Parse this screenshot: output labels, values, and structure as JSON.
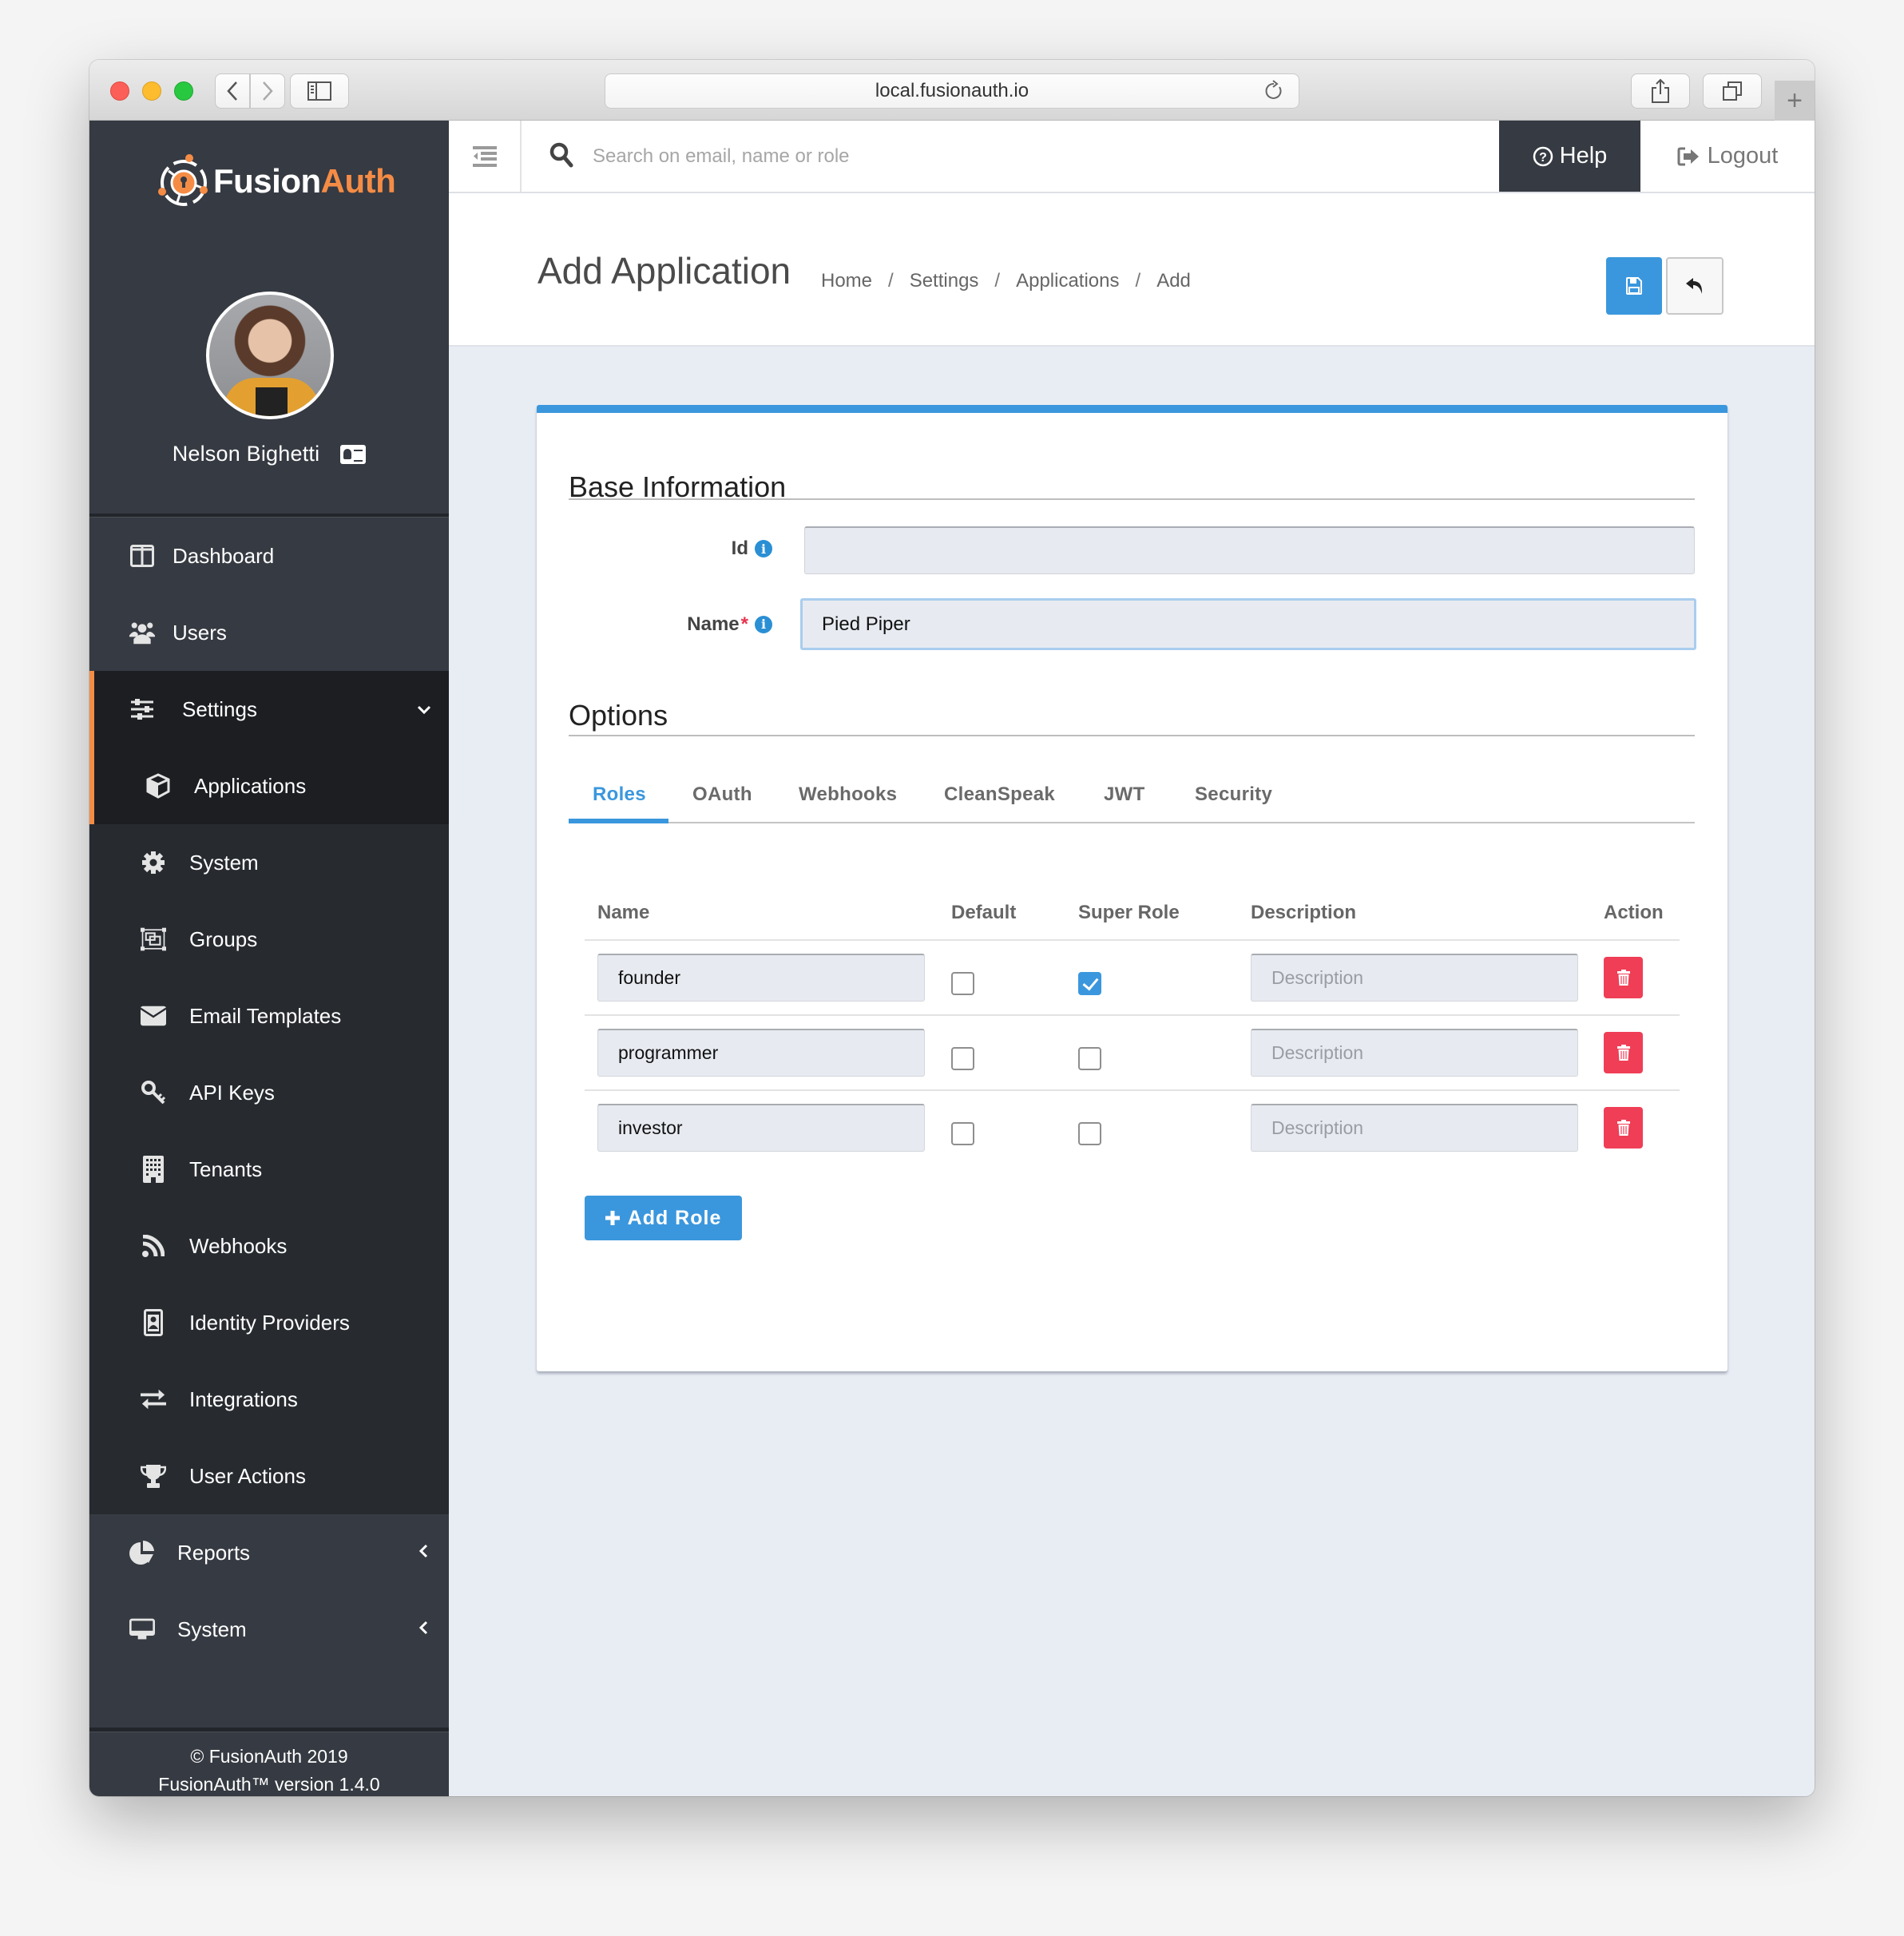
{
  "browser": {
    "url": "local.fusionauth.io",
    "icons": {
      "back": "chevron-left-icon",
      "forward": "chevron-right-icon",
      "sidebar": "sidebar-icon",
      "reload": "reload-icon",
      "share": "share-icon",
      "tabs": "tabs-icon",
      "new_tab": "plus-icon"
    }
  },
  "brand": {
    "name_part1": "Fusion",
    "name_part2": "Auth",
    "accent_color": "#f58c45"
  },
  "user": {
    "name": "Nelson Bighetti"
  },
  "sidebar": {
    "items": [
      {
        "label": "Dashboard",
        "icon": "dashboard-icon"
      },
      {
        "label": "Users",
        "icon": "users-icon"
      }
    ],
    "settings_group": {
      "label": "Settings",
      "icon": "sliders-icon",
      "expanded": true,
      "children": [
        {
          "label": "Applications",
          "icon": "cube-icon",
          "active": true
        },
        {
          "label": "System",
          "icon": "gear-icon"
        },
        {
          "label": "Groups",
          "icon": "groups-icon"
        },
        {
          "label": "Email Templates",
          "icon": "envelope-icon"
        },
        {
          "label": "API Keys",
          "icon": "key-icon"
        },
        {
          "label": "Tenants",
          "icon": "building-icon"
        },
        {
          "label": "Webhooks",
          "icon": "rss-icon"
        },
        {
          "label": "Identity Providers",
          "icon": "id-badge-icon"
        },
        {
          "label": "Integrations",
          "icon": "exchange-icon"
        },
        {
          "label": "User Actions",
          "icon": "trophy-icon"
        }
      ]
    },
    "bottom_items": [
      {
        "label": "Reports",
        "icon": "pie-chart-icon"
      },
      {
        "label": "System",
        "icon": "desktop-icon"
      }
    ],
    "footer": {
      "copyright": "© FusionAuth 2019",
      "version": "FusionAuth™ version 1.4.0"
    }
  },
  "topbar": {
    "search_placeholder": "Search on email, name or role",
    "help_label": "Help",
    "logout_label": "Logout"
  },
  "page": {
    "title": "Add Application",
    "breadcrumb": [
      "Home",
      "Settings",
      "Applications",
      "Add"
    ],
    "breadcrumb_separator": "/"
  },
  "form": {
    "base_section_title": "Base Information",
    "id_label": "Id",
    "id_value": "",
    "name_label": "Name",
    "name_required_mark": "*",
    "name_value": "Pied Piper",
    "options_section_title": "Options",
    "tabs": [
      {
        "label": "Roles",
        "active": true
      },
      {
        "label": "OAuth"
      },
      {
        "label": "Webhooks"
      },
      {
        "label": "CleanSpeak"
      },
      {
        "label": "JWT"
      },
      {
        "label": "Security"
      }
    ]
  },
  "roles_table": {
    "columns": [
      "Name",
      "Default",
      "Super Role",
      "Description",
      "Action"
    ],
    "description_placeholder": "Description",
    "rows": [
      {
        "name": "founder",
        "default": false,
        "super_role": true,
        "description": ""
      },
      {
        "name": "programmer",
        "default": false,
        "super_role": false,
        "description": ""
      },
      {
        "name": "investor",
        "default": false,
        "super_role": false,
        "description": ""
      }
    ],
    "add_role_label": "Add Role"
  },
  "colors": {
    "primary": "#3b97dd",
    "danger": "#ef3e56",
    "sidebar_bg": "#363a42",
    "accent": "#f58c45"
  }
}
